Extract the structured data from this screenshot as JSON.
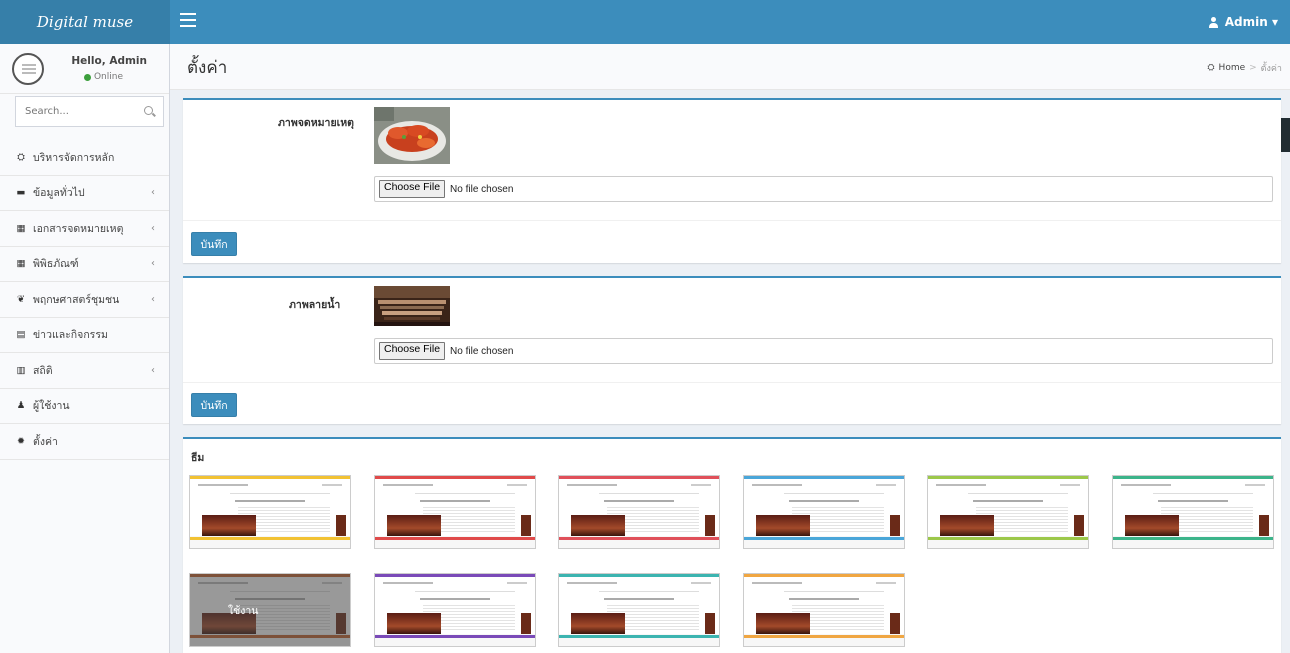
{
  "app": {
    "logo": "Digital muse"
  },
  "header": {
    "user_label": "Admin ▾"
  },
  "sidebar": {
    "hello": "Hello, Admin",
    "status": "Online",
    "search_placeholder": "Search...",
    "items": [
      {
        "label": "บริหารจัดการหลัก",
        "icon": "dashboard-icon",
        "glyph": "⛭",
        "has_children": false
      },
      {
        "label": "ข้อมูลทั่วไป",
        "icon": "folder-icon",
        "glyph": "▬",
        "has_children": true
      },
      {
        "label": "เอกสารจดหมายเหตุ",
        "icon": "grid-icon",
        "glyph": "▦",
        "has_children": true
      },
      {
        "label": "พิพิธภัณฑ์",
        "icon": "grid-icon",
        "glyph": "▦",
        "has_children": true
      },
      {
        "label": "พฤกษศาสตร์ชุมชน",
        "icon": "leaf-icon",
        "glyph": "❦",
        "has_children": true
      },
      {
        "label": "ข่าวและกิจกรรม",
        "icon": "calendar-icon",
        "glyph": "▤",
        "has_children": false
      },
      {
        "label": "สถิติ",
        "icon": "chart-icon",
        "glyph": "▥",
        "has_children": true
      },
      {
        "label": "ผู้ใช้งาน",
        "icon": "user-icon",
        "glyph": "♟",
        "has_children": false
      },
      {
        "label": "ตั้งค่า",
        "icon": "gear-icon",
        "glyph": "✹",
        "has_children": false
      }
    ],
    "chevron": "‹"
  },
  "page": {
    "title": "ตั้งค่า",
    "breadcrumb": {
      "home": "Home",
      "separator": ">",
      "current": "ตั้งค่า"
    }
  },
  "archive_image": {
    "label": "ภาพจดหมายเหตุ",
    "choose_label": "Choose File",
    "no_file": "No file chosen",
    "save_label": "บันทึก"
  },
  "watermark_image": {
    "label": "ภาพลายน้ำ",
    "choose_label": "Choose File",
    "no_file": "No file chosen",
    "save_label": "บันทึก"
  },
  "themes": {
    "title": "ธีม",
    "active_label": "ใช้งาน",
    "colors": [
      "#f2c233",
      "#e04a4a",
      "#e0505a",
      "#4aa6d9",
      "#9cc84a",
      "#3cb48a",
      "#c0602a",
      "#7a4ab8",
      "#3cb4b0",
      "#f0a642"
    ],
    "active_index": 6
  },
  "colors": {
    "primary": "#3c8dbc",
    "primary_dark": "#367fa9",
    "sidebar_bg": "#f9fafc"
  }
}
